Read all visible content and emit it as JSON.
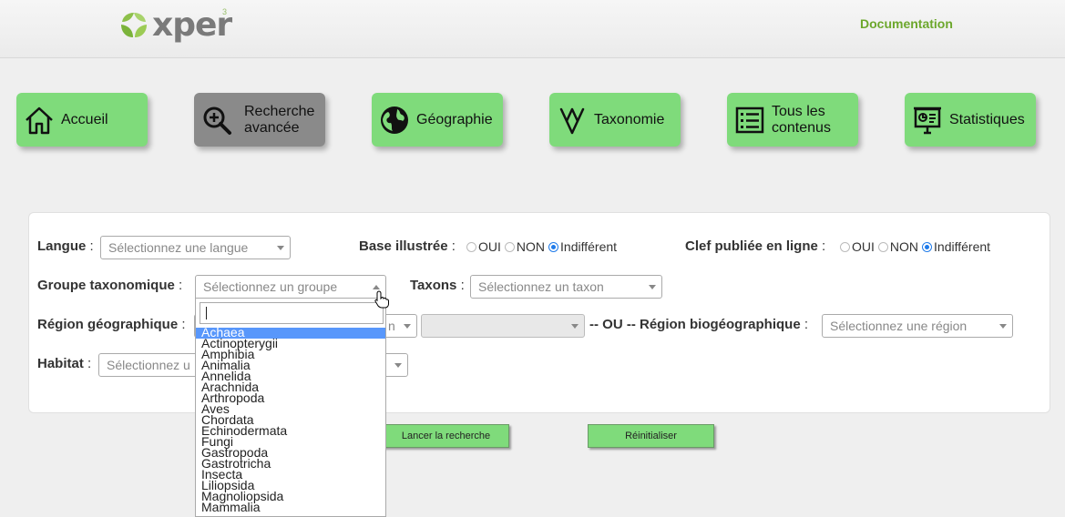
{
  "header": {
    "logo_text": "xper",
    "logo_sup": "3",
    "documentation_link": "Documentation"
  },
  "nav": [
    {
      "label": "Accueil",
      "icon": "home-icon",
      "active": false
    },
    {
      "label": "Recherche avancée",
      "icon": "search-plus-icon",
      "active": true
    },
    {
      "label": "Géographie",
      "icon": "globe-icon",
      "active": false
    },
    {
      "label": "Taxonomie",
      "icon": "tree-branch-icon",
      "active": false
    },
    {
      "label": "Tous les contenus",
      "icon": "list-icon",
      "active": false
    },
    {
      "label": "Statistiques",
      "icon": "presentation-chart-icon",
      "active": false
    }
  ],
  "form": {
    "langue": {
      "label": "Langue",
      "placeholder": "Sélectionnez une langue"
    },
    "base_illustree": {
      "label": "Base illustrée",
      "options": [
        "OUI",
        "NON",
        "Indifférent"
      ],
      "selected": "Indifférent"
    },
    "clef_publiee": {
      "label": "Clef publiée en ligne",
      "options": [
        "OUI",
        "NON",
        "Indifférent"
      ],
      "selected": "Indifférent"
    },
    "groupe": {
      "label": "Groupe taxonomique",
      "placeholder": "Sélectionnez un groupe"
    },
    "taxons": {
      "label": "Taxons",
      "placeholder": "Sélectionnez un taxon"
    },
    "region_geo": {
      "label": "Région géographique",
      "partial_placeholder": "n"
    },
    "ou_separator": "-- OU --",
    "region_bio": {
      "label": "Région biogéographique",
      "placeholder": "Sélectionnez une région"
    },
    "habitat": {
      "label": "Habitat",
      "placeholder": "Sélectionnez u"
    }
  },
  "buttons": {
    "search": "Lancer la recherche",
    "reset": "Réinitialiser"
  },
  "dropdown": {
    "search_value": "",
    "highlighted": "Achaea",
    "items": [
      "Achaea",
      "Actinopterygii",
      "Amphibia",
      "Animalia",
      "Annelida",
      "Arachnida",
      "Arthropoda",
      "Aves",
      "Chordata",
      "Echinodermata",
      "Fungi",
      "Gastropoda",
      "Gastrotricha",
      "Insecta",
      "Liliopsida",
      "Magnoliopsida",
      "Mammalia"
    ]
  },
  "colors": {
    "nav_green": "#7fdb7b",
    "nav_active": "#8a8a8a",
    "doc_link": "#6ca72c",
    "radio_selected": "#1f7bea",
    "dropdown_highlight": "#5897fb"
  }
}
